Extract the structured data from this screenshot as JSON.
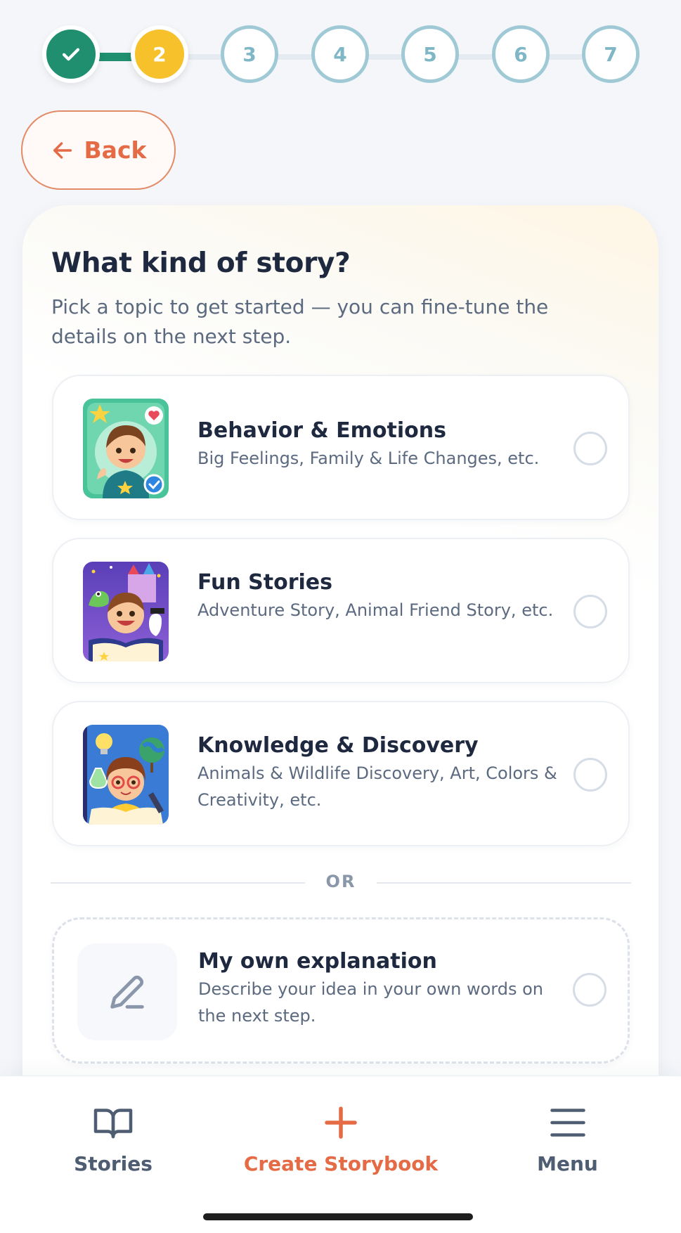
{
  "stepper": {
    "steps": [
      {
        "label": "",
        "state": "done",
        "icon": "check-icon"
      },
      {
        "label": "2",
        "state": "current"
      },
      {
        "label": "3",
        "state": "todo"
      },
      {
        "label": "4",
        "state": "todo"
      },
      {
        "label": "5",
        "state": "todo"
      },
      {
        "label": "6",
        "state": "todo"
      },
      {
        "label": "7",
        "state": "todo"
      }
    ],
    "colors": {
      "done": "#1f8f6f",
      "current": "#f6c12b",
      "todo": "#9fc9d5"
    }
  },
  "back": {
    "label": "Back",
    "icon": "arrow-left-icon"
  },
  "page": {
    "title": "What kind of story?",
    "subtitle": "Pick a topic to get started — you can fine-tune the details on the next step."
  },
  "options": [
    {
      "title": "Behavior & Emotions",
      "description": "Big Feelings, Family & Life Changes, etc.",
      "selected": false
    },
    {
      "title": "Fun Stories",
      "description": "Adventure Story, Animal Friend Story, etc.",
      "selected": false
    },
    {
      "title": "Knowledge & Discovery",
      "description": "Animals & Wildlife Discovery, Art, Colors & Creativity, etc.",
      "selected": false
    }
  ],
  "divider": {
    "label": "OR"
  },
  "own": {
    "title": "My own explanation",
    "description": "Describe your idea in your own words on the next step.",
    "icon": "pencil-icon",
    "selected": false
  },
  "nav": {
    "stories": {
      "label": "Stories",
      "icon": "book-open-icon"
    },
    "create": {
      "label": "Create Storybook",
      "icon": "plus-icon"
    },
    "menu": {
      "label": "Menu",
      "icon": "hamburger-menu-icon"
    }
  },
  "theme": {
    "accent": "#e46b45",
    "text": "#1e2940",
    "muted": "#5c6a80"
  }
}
